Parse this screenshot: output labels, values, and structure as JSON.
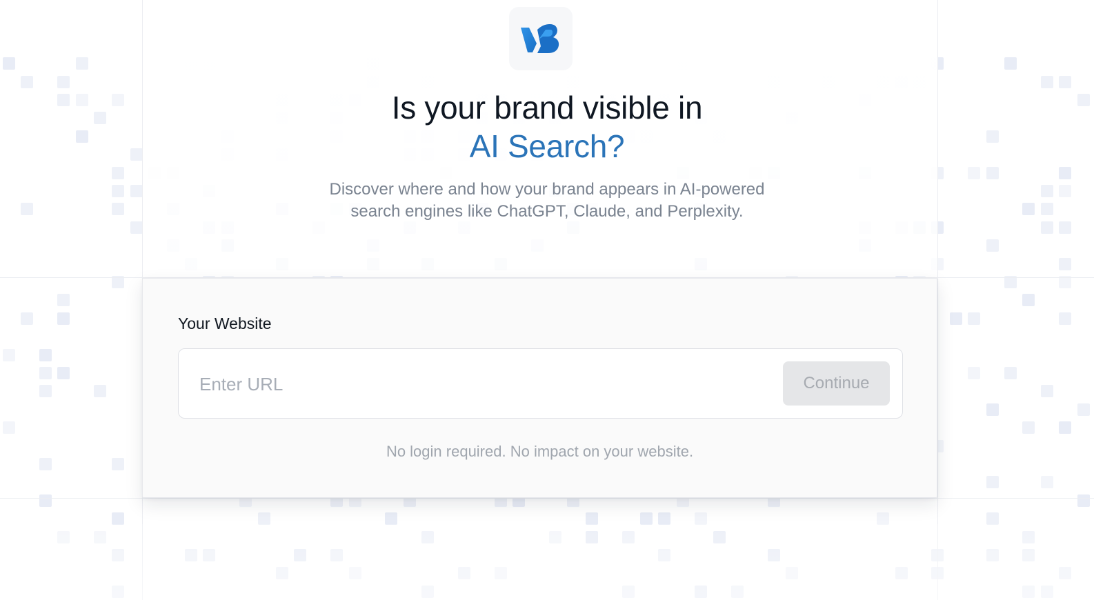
{
  "brand": {
    "logo_icon": "vb-logo-icon",
    "accent_color": "#2b74b8"
  },
  "hero": {
    "headline_line1": "Is your brand visible in",
    "headline_line2": "AI Search?",
    "subtitle_line1": "Discover where and how your brand appears in AI-powered",
    "subtitle_line2": "search engines like ChatGPT, Claude, and Perplexity."
  },
  "form": {
    "label": "Your Website",
    "url_placeholder": "Enter URL",
    "url_value": "",
    "continue_label": "Continue",
    "note": "No login required. No impact on your website."
  }
}
